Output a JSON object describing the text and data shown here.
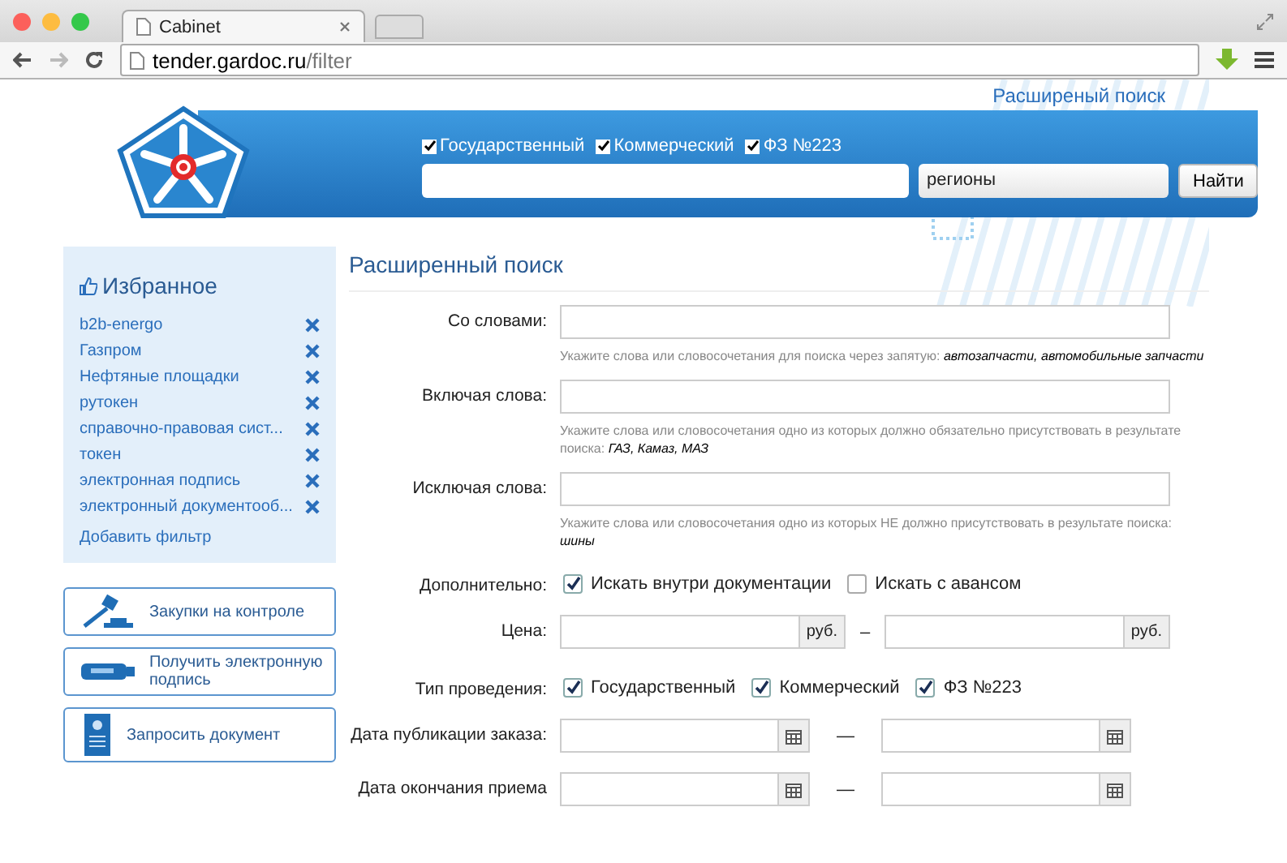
{
  "browser": {
    "tab_title": "Cabinet",
    "url_host": "tender.gardoc.ru",
    "url_path": "/filter"
  },
  "header": {
    "advanced_link": "Расширеный поиск",
    "types": [
      {
        "label": "Государственный",
        "checked": true
      },
      {
        "label": "Коммерческий",
        "checked": true
      },
      {
        "label": "ФЗ №223",
        "checked": true
      }
    ],
    "region": "регионы",
    "search_button": "Найти"
  },
  "sidebar": {
    "favorites_title": "Избранное",
    "favorites": [
      {
        "label": "b2b-energo"
      },
      {
        "label": "Газпром"
      },
      {
        "label": "Нефтяные площадки"
      },
      {
        "label": "рутокен"
      },
      {
        "label": "справочно-правовая сист..."
      },
      {
        "label": "токен"
      },
      {
        "label": "электронная подпись"
      },
      {
        "label": "электронный документооб..."
      }
    ],
    "add_filter": "Добавить фильтр",
    "actions": [
      {
        "kind": "gavel",
        "label": "Закупки на контроле"
      },
      {
        "kind": "usb",
        "label": "Получить электронную подпись"
      },
      {
        "kind": "document",
        "label": "Запросить документ"
      }
    ]
  },
  "form": {
    "title": "Расширенный поиск",
    "rows": [
      {
        "kind": "text",
        "label": "Со словами:",
        "hint": "Укажите слова или словосочетания для поиска через запятую: *автозапчасти, автомобильные запчасти*"
      },
      {
        "kind": "text",
        "label": "Включая слова:",
        "hint": "Укажите слова или словосочетания одно из которых должно обязательно присутствовать в результате поиска: *ГАЗ, Камаз, МАЗ*"
      },
      {
        "kind": "text",
        "label": "Исключая слова:",
        "hint": "Укажите слова или словосочетания одно из которых НЕ должно присутствовать в результате поиска: *шины*"
      },
      {
        "kind": "checks",
        "label": "Дополнительно:",
        "options": [
          {
            "label": "Искать внутри документации",
            "checked": true
          },
          {
            "label": "Искать с авансом",
            "checked": false
          }
        ]
      },
      {
        "kind": "price",
        "label": "Цена:",
        "unit_from": "руб.",
        "unit_to": "руб.",
        "separator": "–"
      },
      {
        "kind": "checks",
        "label": "Тип проведения:",
        "options": [
          {
            "label": "Государственный",
            "checked": true
          },
          {
            "label": "Коммерческий",
            "checked": true
          },
          {
            "label": "ФЗ №223",
            "checked": true
          }
        ]
      },
      {
        "kind": "date",
        "label": "Дата публикации заказа:",
        "separator": "—"
      },
      {
        "kind": "date",
        "label": "Дата окончания приема",
        "separator": "—"
      }
    ]
  }
}
